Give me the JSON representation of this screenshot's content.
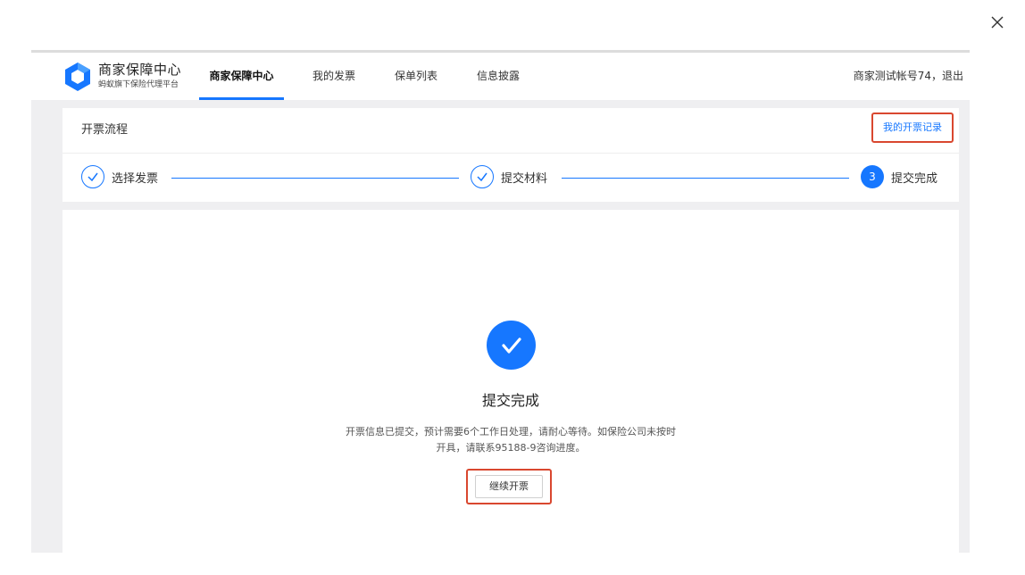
{
  "modal": {
    "close_icon": "close-icon"
  },
  "brand": {
    "title": "商家保障中心",
    "subtitle": "蚂蚁旗下保险代理平台",
    "logo_icon": "hexagon-logo-icon"
  },
  "nav": {
    "items": [
      {
        "label": "商家保障中心",
        "active": true
      },
      {
        "label": "我的发票",
        "active": false
      },
      {
        "label": "保单列表",
        "active": false
      },
      {
        "label": "信息披露",
        "active": false
      }
    ]
  },
  "user": {
    "account": "商家测试帐号74",
    "separator": "，",
    "logout": "退出"
  },
  "process": {
    "title": "开票流程",
    "record_link": "我的开票记录",
    "steps": [
      {
        "label": "选择发票",
        "status": "done"
      },
      {
        "label": "提交材料",
        "status": "done"
      },
      {
        "label": "提交完成",
        "status": "current",
        "number": "3"
      }
    ]
  },
  "result": {
    "title": "提交完成",
    "description_line1": "开票信息已提交，预计需要6个工作日处理，请耐心等待。如保险公司未按时",
    "description_line2": "开具，请联系95188-9咨询进度。",
    "continue_button": "继续开票"
  },
  "colors": {
    "accent": "#1677ff",
    "highlight_border": "#d9472f",
    "page_bg": "#efeff1"
  }
}
